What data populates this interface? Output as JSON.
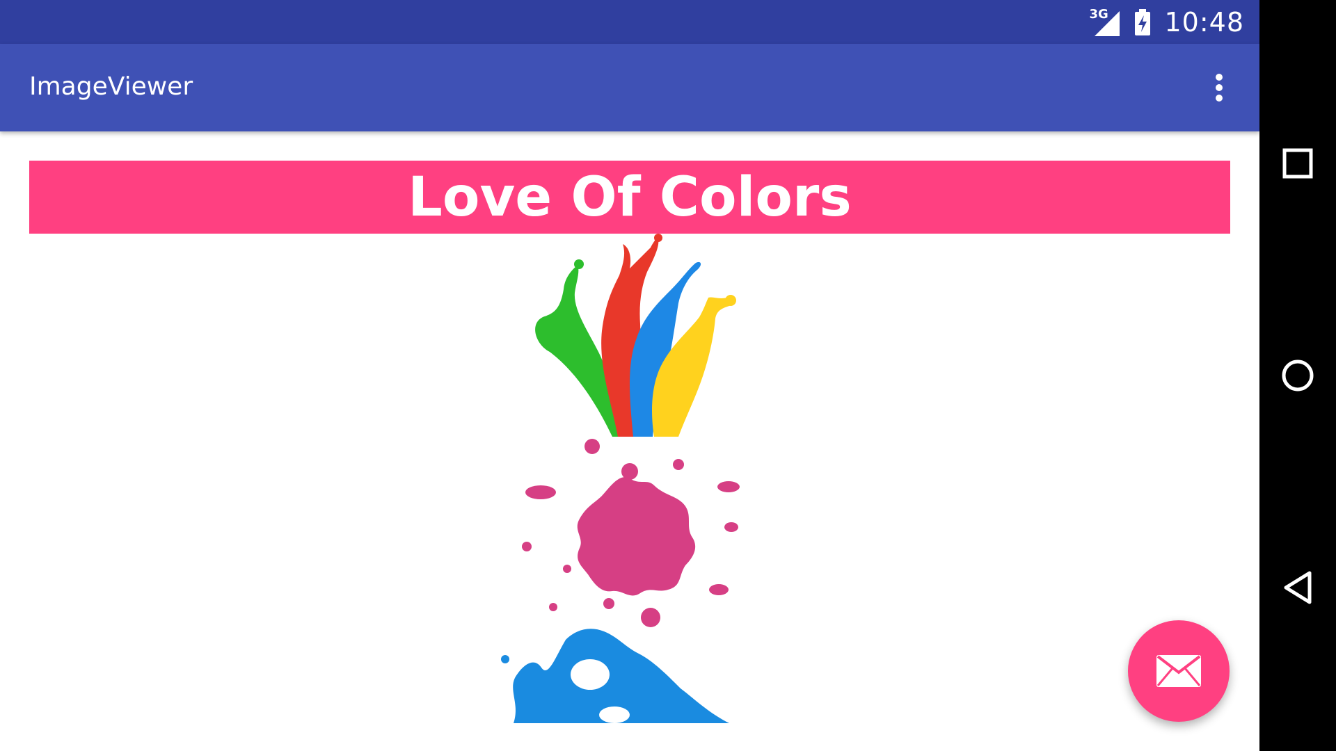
{
  "status_bar": {
    "network_label": "3G",
    "time": "10:48",
    "icons": [
      "signal-icon",
      "battery-charging-icon"
    ]
  },
  "app_bar": {
    "title": "ImageViewer",
    "menu_icon": "more-vert-icon"
  },
  "banner": {
    "text": "Love Of Colors"
  },
  "images": [
    "paint-splash-multicolor",
    "paint-splatter-pink",
    "paint-splash-blue"
  ],
  "fab": {
    "icon": "mail-icon"
  },
  "nav_bar": {
    "icons": [
      "recents-square-icon",
      "home-circle-icon",
      "back-triangle-icon"
    ]
  },
  "colors": {
    "status_bar": "#303F9F",
    "app_bar": "#3F51B5",
    "accent": "#FF4081"
  }
}
